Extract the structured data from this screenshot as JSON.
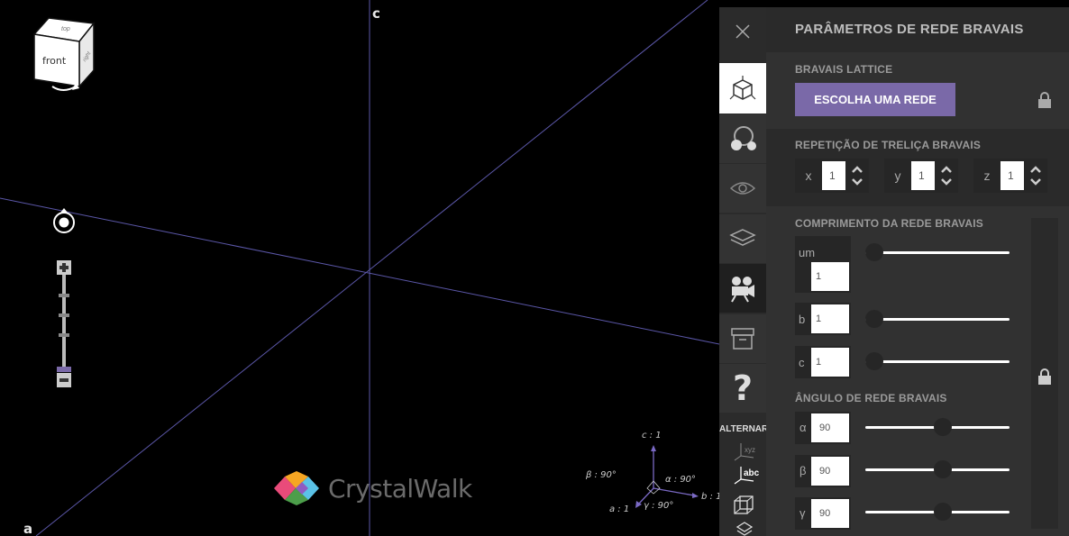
{
  "viewport": {
    "axis_labels": {
      "c": "c",
      "a": "a"
    },
    "view_cube": {
      "front_face": "front",
      "top_face": "top",
      "side_face": "right"
    },
    "logo_text": "CrystalWalk"
  },
  "mini_axes": {
    "c_label": "c : 1",
    "a_label": "a : 1",
    "b_label": "b : 1",
    "alpha": "α : 90°",
    "beta": "β : 90°",
    "gamma": "γ : 90°"
  },
  "sidebar": {
    "close_icon": "close-icon",
    "items": [
      {
        "name": "lattice",
        "icon": "cube-icon",
        "active": true
      },
      {
        "name": "motif",
        "icon": "atoms-icon"
      },
      {
        "name": "visualization",
        "icon": "eye-icon"
      },
      {
        "name": "layers",
        "icon": "layers-icon"
      },
      {
        "name": "camera",
        "icon": "camera-icon"
      },
      {
        "name": "archive",
        "icon": "archive-icon"
      },
      {
        "name": "help",
        "icon": "question-icon",
        "label": "?"
      }
    ],
    "alternar_label": "ALTERNAR",
    "toggle_xyz": "xyz",
    "toggle_abc": "abc"
  },
  "panel": {
    "title": "PARÂMETROS DE REDE BRAVAIS",
    "lattice_section": "BRAVAIS LATTICE",
    "choose_button": "ESCOLHA UMA REDE",
    "repeat_section": "REPETIÇÃO DE TRELIÇA BRAVAIS",
    "repeat": [
      {
        "axis": "x",
        "value": "1"
      },
      {
        "axis": "y",
        "value": "1"
      },
      {
        "axis": "z",
        "value": "1"
      }
    ],
    "length_section": "COMPRIMENTO DA REDE BRAVAIS",
    "lengths": [
      {
        "label": "um",
        "value": "1"
      },
      {
        "label": "b",
        "value": "1"
      },
      {
        "label": "c",
        "value": "1"
      }
    ],
    "angle_section": "ÂNGULO DE REDE BRAVAIS",
    "angles": [
      {
        "label": "α",
        "value": "90"
      },
      {
        "label": "β",
        "value": "90"
      },
      {
        "label": "γ",
        "value": "90"
      }
    ]
  },
  "colors": {
    "accent": "#7a69a8",
    "axis_line": "#6a5fc4",
    "panel": "#313131"
  }
}
